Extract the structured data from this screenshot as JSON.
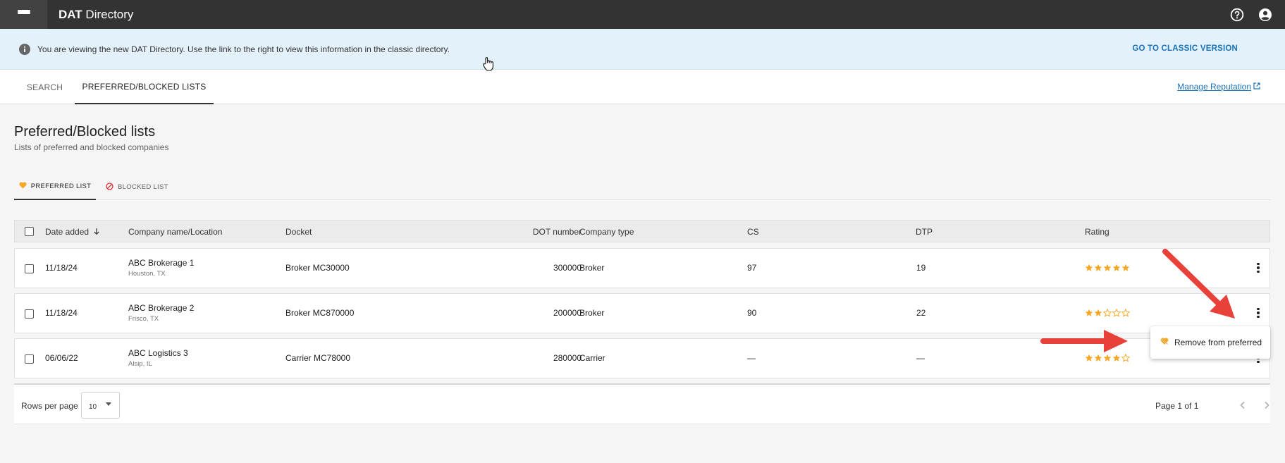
{
  "app": {
    "brand_bold": "DAT",
    "brand_rest": " Directory"
  },
  "banner": {
    "message": "You are viewing the new DAT Directory. Use the link to the right to view this information in the classic directory.",
    "link": "GO TO CLASSIC VERSION"
  },
  "tabs": {
    "search": "SEARCH",
    "lists": "PREFERRED/BLOCKED LISTS",
    "manage": "Manage Reputation"
  },
  "page": {
    "title": "Preferred/Blocked lists",
    "subtitle": "Lists of preferred and blocked companies"
  },
  "subtabs": {
    "preferred": "PREFERRED LIST",
    "blocked": "BLOCKED LIST"
  },
  "table": {
    "columns": {
      "date": "Date added",
      "company": "Company name/Location",
      "docket": "Docket",
      "dot": "DOT number",
      "type": "Company type",
      "cs": "CS",
      "dtp": "DTP",
      "rating": "Rating"
    },
    "rows": [
      {
        "date": "11/18/24",
        "company": "ABC Brokerage 1",
        "location": "Houston, TX",
        "docket": "Broker MC30000",
        "dot": "300000",
        "type": "Broker",
        "cs": "97",
        "dtp": "19",
        "rating": 5
      },
      {
        "date": "11/18/24",
        "company": "ABC Brokerage 2",
        "location": "Frisco, TX",
        "docket": "Broker MC870000",
        "dot": "200000",
        "type": "Broker",
        "cs": "90",
        "dtp": "22",
        "rating": 2
      },
      {
        "date": "06/06/22",
        "company": "ABC Logistics 3",
        "location": "Alsip, IL",
        "docket": "Carrier MC78000",
        "dot": "280000",
        "type": "Carrier",
        "cs": "—",
        "dtp": "—",
        "rating": 4
      }
    ]
  },
  "footer": {
    "rows_per_page_label": "Rows per page",
    "rows_per_page_value": "10",
    "page_info": "Page 1 of 1"
  },
  "popup": {
    "label": "Remove from preferred"
  },
  "colors": {
    "appbar": "#333333",
    "banner_bg": "#e3f1fa",
    "link": "#1a73b8",
    "star": "#f5a623",
    "arrow": "#e8413a"
  }
}
